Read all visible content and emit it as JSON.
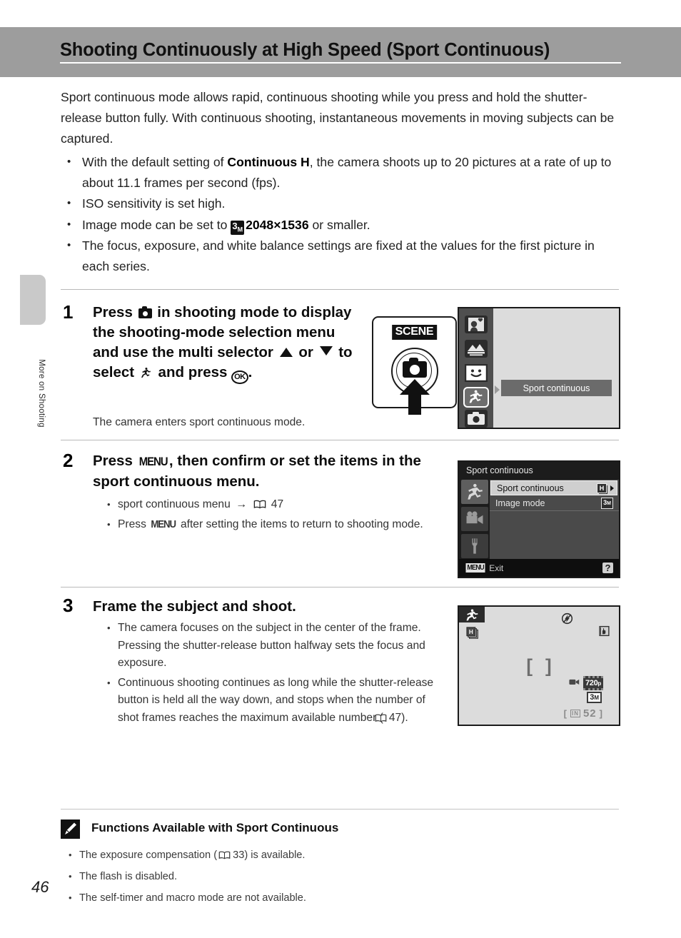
{
  "page": {
    "number": "46",
    "side_tab": "More on Shooting"
  },
  "header": {
    "title": "Shooting Continuously at High Speed (Sport Continuous)"
  },
  "intro": {
    "paragraph": "Sport continuous mode allows rapid, continuous shooting while you press and hold the shutter-release button fully. With continuous shooting, instantaneous movements in moving subjects can be captured.",
    "bullets": [
      {
        "pre": "With the default setting of ",
        "bold": "Continuous H",
        "post": ", the camera shoots up to 20 pictures at a rate of up to about 11.1 frames per second (fps)."
      },
      {
        "pre": "ISO sensitivity is set high.",
        "bold": "",
        "post": ""
      },
      {
        "pre": "Image mode can be set to ",
        "bold": "2048×1536",
        "post": " or smaller.",
        "icon": "image-mode-3m-icon"
      },
      {
        "pre": "The focus, exposure, and white balance settings are fixed at the values for the first picture in each series.",
        "bold": "",
        "post": ""
      }
    ]
  },
  "steps": [
    {
      "number": "1",
      "head_part1": "Press",
      "head_part2": "in shooting mode to display the shooting-mode selection menu and use the multi selector",
      "head_or": "or",
      "head_part3": "to select",
      "head_part4": "and press",
      "head_end": ".",
      "sub": "The camera enters sport continuous mode."
    },
    {
      "number": "2",
      "head_part1": "Press",
      "head_menu": "MENU",
      "head_part2": ", then confirm or set the items in the sport continuous menu.",
      "bullets": [
        {
          "text_pre": "sport continuous menu",
          "arrow": "→",
          "page_ref": "47"
        },
        {
          "text_pre": "Press",
          "menu": "MENU",
          "text_post": "after setting the items to return to shooting mode."
        }
      ]
    },
    {
      "number": "3",
      "head": "Frame the subject and shoot.",
      "bullets": [
        "The camera focuses on the subject in the center of the frame. Pressing the shutter-release button halfway sets the focus and exposure.",
        "Continuous shooting continues as long while the shutter-release button is held all the way down, and stops when the number of shot frames reaches the maximum available number (  47)."
      ],
      "bullet2_pre": "Continuous shooting continues as long while the shutter-release button is held all the way down, and stops when the number of shot frames reaches the maximum available number (",
      "bullet2_ref": "47",
      "bullet2_post": ")."
    }
  ],
  "figures": {
    "camera_button": {
      "scene_label": "SCENE",
      "camera_icon": "camera-icon",
      "arrow_icon": "arrow-up-icon"
    },
    "mode_menu": {
      "tooltip": "Sport continuous",
      "icons": [
        "portrait-mode-icon",
        "night-landscape-mode-icon",
        "smile-detect-mode-icon",
        "sport-continuous-mode-icon",
        "auto-mode-icon"
      ],
      "selected_index": 3
    },
    "sport_menu": {
      "title": "Sport continuous",
      "rows": [
        {
          "label": "Sport continuous",
          "badge": "H",
          "highlighted": true,
          "has_caret": true
        },
        {
          "label": "Image mode",
          "badge": "3M",
          "highlighted": false,
          "has_caret": false
        }
      ],
      "tabs": [
        "sport-tab-icon",
        "movie-tab-icon",
        "setup-tab-icon"
      ],
      "footer_key": "MENU",
      "footer_label": "Exit",
      "help_label": "?"
    },
    "live_view": {
      "mode_icon": "sport-continuous-icon",
      "continuous_icon": "continuous-h-icon",
      "flash_off_icon": "flash-off-icon",
      "vr_icon": "vibration-reduction-icon",
      "focus_brackets": [
        "[",
        "]"
      ],
      "movie_badge": "720",
      "movie_badge_sub": "p",
      "image_mode_badge": "3M",
      "memory_icon": "IN",
      "shots_remaining": "52"
    }
  },
  "note": {
    "icon": "pencil-note-icon",
    "title": "Functions Available with Sport Continuous",
    "bullets": [
      {
        "pre": "The exposure compensation (",
        "ref": "33",
        "post": ") is available."
      },
      {
        "pre": "The flash is disabled.",
        "ref": "",
        "post": ""
      },
      {
        "pre": "The self-timer and macro mode are not available.",
        "ref": "",
        "post": ""
      }
    ]
  }
}
